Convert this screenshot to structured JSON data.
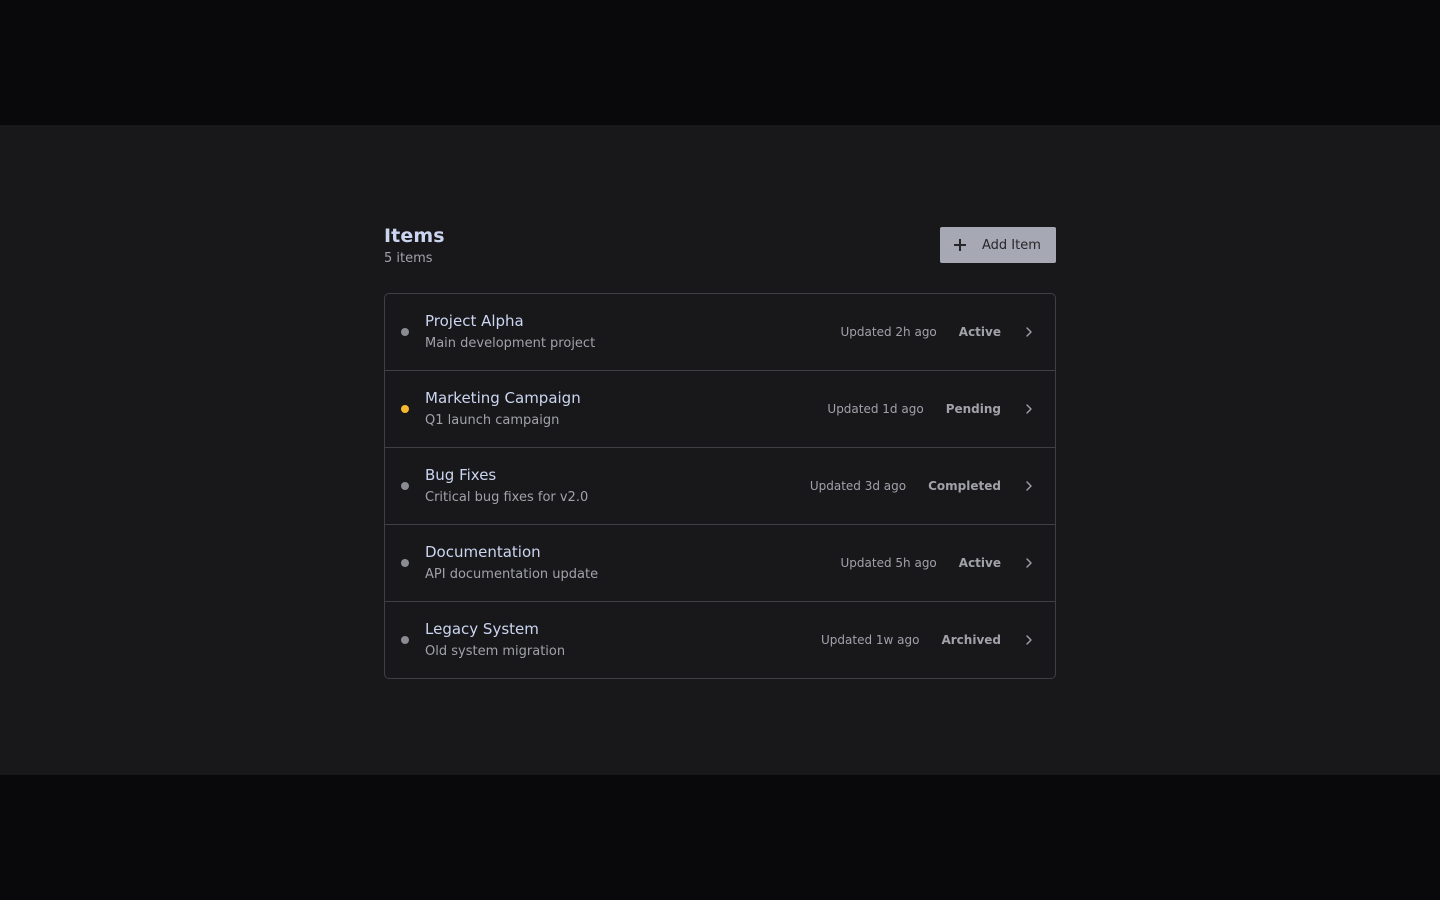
{
  "header": {
    "title": "Items",
    "count": "5 items",
    "add_label": "Add Item"
  },
  "colors": {
    "dot_default": "#8b8b94",
    "dot_pending": "#f5b82e"
  },
  "items": [
    {
      "name": "Project Alpha",
      "description": "Main development project",
      "updated": "Updated 2h ago",
      "status": "Active",
      "dot": "#8b8b94"
    },
    {
      "name": "Marketing Campaign",
      "description": "Q1 launch campaign",
      "updated": "Updated 1d ago",
      "status": "Pending",
      "dot": "#f5b82e"
    },
    {
      "name": "Bug Fixes",
      "description": "Critical bug fixes for v2.0",
      "updated": "Updated 3d ago",
      "status": "Completed",
      "dot": "#8b8b94"
    },
    {
      "name": "Documentation",
      "description": "API documentation update",
      "updated": "Updated 5h ago",
      "status": "Active",
      "dot": "#8b8b94"
    },
    {
      "name": "Legacy System",
      "description": "Old system migration",
      "updated": "Updated 1w ago",
      "status": "Archived",
      "dot": "#8b8b94"
    }
  ]
}
